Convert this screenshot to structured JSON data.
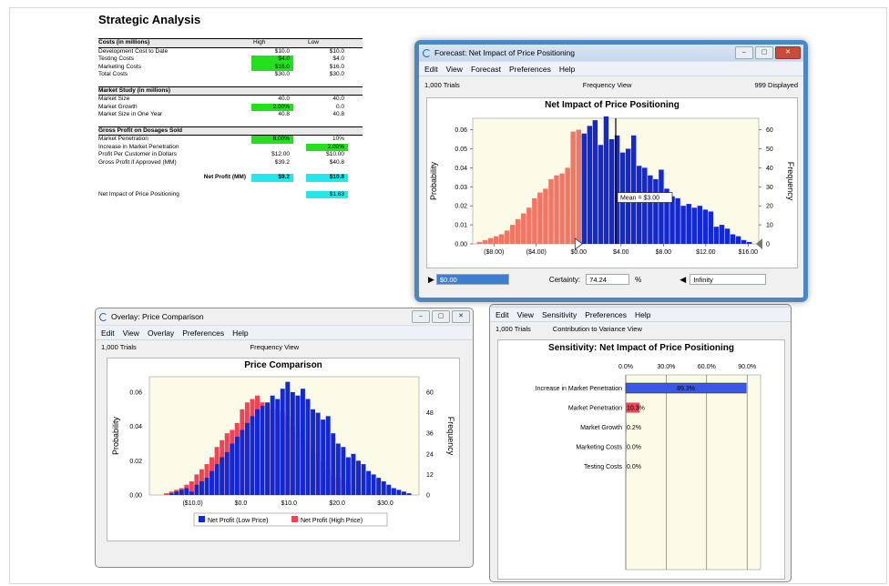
{
  "sheet": {
    "title": "Strategic Analysis",
    "costs": {
      "header": "Costs (in millions)",
      "high_label": "High",
      "low_label": "Low",
      "rows": [
        {
          "label": "Development Cost to Date",
          "high": "$10.0",
          "low": "$10.0"
        },
        {
          "label": "Testing Costs",
          "high": "$4.0",
          "low": "$4.0"
        },
        {
          "label": "Marketing Costs",
          "high": "$16.0",
          "low": "$16.0"
        },
        {
          "label": "Total Costs",
          "high": "$30.0",
          "low": "$30.0"
        }
      ]
    },
    "market": {
      "header": "Market Study (in millions)",
      "rows": [
        {
          "label": "Market Size",
          "high": "40.0",
          "low": "40.0"
        },
        {
          "label": "Market Growth",
          "high": "2.00%",
          "low": "0.0"
        },
        {
          "label": "Market Size in One Year",
          "high": "40.8",
          "low": "40.8"
        }
      ]
    },
    "gross": {
      "header": "Gross Profit on Dosages Sold",
      "rows": [
        {
          "label": "Market Penetration",
          "high": "8.00%",
          "low": "10%"
        },
        {
          "label": "Increase in Market Penetration",
          "high": "",
          "low": "2.00%"
        },
        {
          "label": "Profit Per Customer in Dollars",
          "high": "$12.00",
          "low": "$10.00"
        },
        {
          "label": "Gross Profit if Approved (MM)",
          "high": "$39.2",
          "low": "$40.8"
        }
      ]
    },
    "net_profit": {
      "label": "Net Profit (MM)",
      "high": "$9.2",
      "low": "$10.8"
    },
    "impact": {
      "label": "Net Impact of Price Positioning",
      "value": "$1.63"
    }
  },
  "forecast": {
    "title": "Forecast: Net Impact of Price Positioning",
    "menu": [
      "Edit",
      "View",
      "Forecast",
      "Preferences",
      "Help"
    ],
    "trials": "1,000 Trials",
    "view": "Frequency View",
    "displayed": "999 Displayed",
    "chart_data": {
      "type": "bar",
      "title": "Net Impact of Price Positioning",
      "ylabel": "Probability",
      "y2label": "Frequency",
      "x_ticks": [
        "($8.00)",
        "($4.00)",
        "$0.00",
        "$4.00",
        "$8.00",
        "$12.00",
        "$16.00"
      ],
      "x_tick_values": [
        -8,
        -4,
        0,
        4,
        8,
        12,
        16
      ],
      "y_ticks": [
        "0.00",
        "0.01",
        "0.02",
        "0.03",
        "0.04",
        "0.05",
        "0.06"
      ],
      "y2_ticks": [
        "0",
        "10",
        "20",
        "30",
        "40",
        "50",
        "60"
      ],
      "xlim": [
        -10,
        17
      ],
      "ylim": [
        0,
        0.066
      ],
      "bin_width": 0.52,
      "bins_start": -9.6,
      "values": [
        0.001,
        0.002,
        0.003,
        0.004,
        0.005,
        0.007,
        0.01,
        0.013,
        0.016,
        0.019,
        0.024,
        0.027,
        0.029,
        0.034,
        0.036,
        0.037,
        0.04,
        0.059,
        0.06,
        0.058,
        0.062,
        0.065,
        0.052,
        0.067,
        0.055,
        0.057,
        0.048,
        0.05,
        0.057,
        0.041,
        0.04,
        0.036,
        0.034,
        0.039,
        0.029,
        0.025,
        0.024,
        0.02,
        0.021,
        0.019,
        0.02,
        0.018,
        0.017,
        0.009,
        0.01,
        0.008,
        0.005,
        0.004,
        0.002,
        0.001
      ],
      "split_at": 0,
      "colors": {
        "left": "#ee7766",
        "right": "#1428d0"
      },
      "mean_label": "Mean = $3.00",
      "mean": 3.5
    },
    "lower_value": "$0.00",
    "certainty_label": "Certainty:",
    "certainty_value": "74.24",
    "certainty_unit": "%",
    "upper_value": "Infinity"
  },
  "overlay": {
    "title": "Overlay: Price Comparison",
    "menu": [
      "Edit",
      "View",
      "Overlay",
      "Preferences",
      "Help"
    ],
    "trials": "1,000 Trials",
    "view": "Frequency View",
    "chart_data": {
      "type": "bar",
      "title": "Price Comparison",
      "ylabel": "Probability",
      "y2label": "Frequency",
      "x_ticks": [
        "($10.0)",
        "$0.0",
        "$10.0",
        "$20.0",
        "$30.0"
      ],
      "x_tick_values": [
        -10,
        0,
        10,
        20,
        30
      ],
      "y_ticks": [
        "0.00",
        "0.02",
        "0.04",
        "0.06"
      ],
      "y2_ticks": [
        "0",
        "12",
        "24",
        "36",
        "48",
        "60"
      ],
      "xlim": [
        -19,
        37
      ],
      "ylim": [
        0,
        0.069
      ],
      "bins_start": -17,
      "bin_width": 1.05,
      "series": [
        {
          "name": "Net Profit (Low Price)",
          "color": "#1428d0",
          "values": [
            0,
            0,
            0.001,
            0.002,
            0.003,
            0.004,
            0.002,
            0.006,
            0.008,
            0.01,
            0.014,
            0.018,
            0.022,
            0.025,
            0.03,
            0.034,
            0.038,
            0.042,
            0.046,
            0.05,
            0.052,
            0.054,
            0.058,
            0.056,
            0.062,
            0.066,
            0.06,
            0.058,
            0.062,
            0.056,
            0.05,
            0.048,
            0.044,
            0.046,
            0.036,
            0.03,
            0.028,
            0.022,
            0.024,
            0.02,
            0.018,
            0.014,
            0.012,
            0.01,
            0.008,
            0.006,
            0.004,
            0.003,
            0.002,
            0.001
          ]
        },
        {
          "name": "Net Profit (High Price)",
          "color": "#ee4455",
          "values": [
            0,
            0.001,
            0.002,
            0.003,
            0.004,
            0.006,
            0.008,
            0.012,
            0.015,
            0.018,
            0.022,
            0.028,
            0.032,
            0.036,
            0.038,
            0.042,
            0.05,
            0.054,
            0.056,
            0.058,
            0.054,
            0.052,
            0.05,
            0.05,
            0.048,
            0.046,
            0.04,
            0.036,
            0.032,
            0.028,
            0.026,
            0.024,
            0.02,
            0.016,
            0.012,
            0.01,
            0.008,
            0.006,
            0.004,
            0.003,
            0.002,
            0.001,
            0,
            0,
            0,
            0,
            0,
            0,
            0,
            0
          ]
        }
      ]
    }
  },
  "sensitivity": {
    "menu": [
      "Edit",
      "View",
      "Sensitivity",
      "Preferences",
      "Help"
    ],
    "trials": "1,000 Trials",
    "view": "Contribution to Variance View",
    "chart_data": {
      "type": "bar",
      "title": "Sensitivity: Net Impact of Price Positioning",
      "x_ticks": [
        "0.0%",
        "30.0%",
        "60.0%",
        "90.0%"
      ],
      "x_tick_values": [
        0,
        30,
        60,
        90
      ],
      "xlim": [
        0,
        100
      ],
      "categories": [
        "Increase in Market Penetration",
        "Market Penetration",
        "Market Growth",
        "Marketing Costs",
        "Testing Costs"
      ],
      "values": [
        89.3,
        10.3,
        0.2,
        0.0,
        0.0
      ],
      "labels": [
        "89.3%",
        "10.3%",
        "0.2%",
        "0.0%",
        "0.0%"
      ],
      "colors": [
        "#3a58e8",
        "#ee4455",
        "#888888",
        "#888888",
        "#888888"
      ]
    }
  }
}
